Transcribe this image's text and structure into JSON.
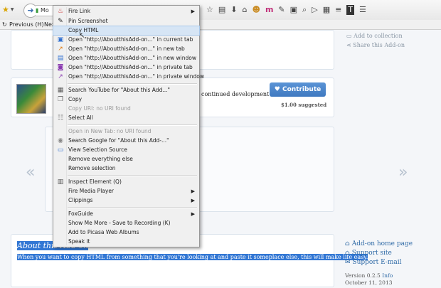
{
  "toolbar": {
    "url_text": "Mo",
    "previous_label": "Previous (H)",
    "next_label": "Nex"
  },
  "sidebar_links": {
    "add_to_collection": "Add to collection",
    "share": "Share this Add-on"
  },
  "contribute": {
    "text": "continued development",
    "button": "Contribute",
    "suggested": "$1.00 suggested"
  },
  "about": {
    "title": "About this Add-on",
    "description": "When you want to copy HTML from something that you're looking at and paste it someplace else, this will make life easy."
  },
  "right_links": {
    "home": "Add-on home page",
    "support": "Support site",
    "email": "Support E-mail",
    "version_prefix": "Version 0.2.5",
    "version_info": "Info",
    "date": "October 11, 2013"
  },
  "context_menu": {
    "items": [
      {
        "label": "Fire Link",
        "submenu": true
      },
      {
        "label": "Pin Screenshot"
      },
      {
        "label": "Copy HTML",
        "hover": true
      },
      {
        "label": "Open \"http://AboutthisAdd-on...\" in current tab"
      },
      {
        "label": "Open \"http://AboutthisAdd-on...\" in new tab"
      },
      {
        "label": "Open \"http://AboutthisAdd-on...\" in new window"
      },
      {
        "label": "Open \"http://AboutthisAdd-on...\" in private tab"
      },
      {
        "label": "Open \"http://AboutthisAdd-on...\" in private window"
      },
      {
        "label": "Search YouTube for \"About this Add...\""
      },
      {
        "label": "Copy"
      },
      {
        "label": "Copy URI: no URI found",
        "disabled": true
      },
      {
        "label": "Select All"
      },
      {
        "label": "Open in New Tab: no URI found",
        "disabled": true
      },
      {
        "label": "Search Google for \"About this Add-...\""
      },
      {
        "label": "View Selection Source"
      },
      {
        "label": "Remove everything else"
      },
      {
        "label": "Remove selection"
      },
      {
        "label": "Inspect Element (Q)"
      },
      {
        "label": "Fire Media Player",
        "submenu": true
      },
      {
        "label": "Clippings",
        "submenu": true
      },
      {
        "label": "FoxGuide",
        "submenu": true
      },
      {
        "label": "Show Me More - Save to Recording (K)"
      },
      {
        "label": "Add to Picasa Web Albums"
      },
      {
        "label": "Speak it"
      }
    ]
  }
}
